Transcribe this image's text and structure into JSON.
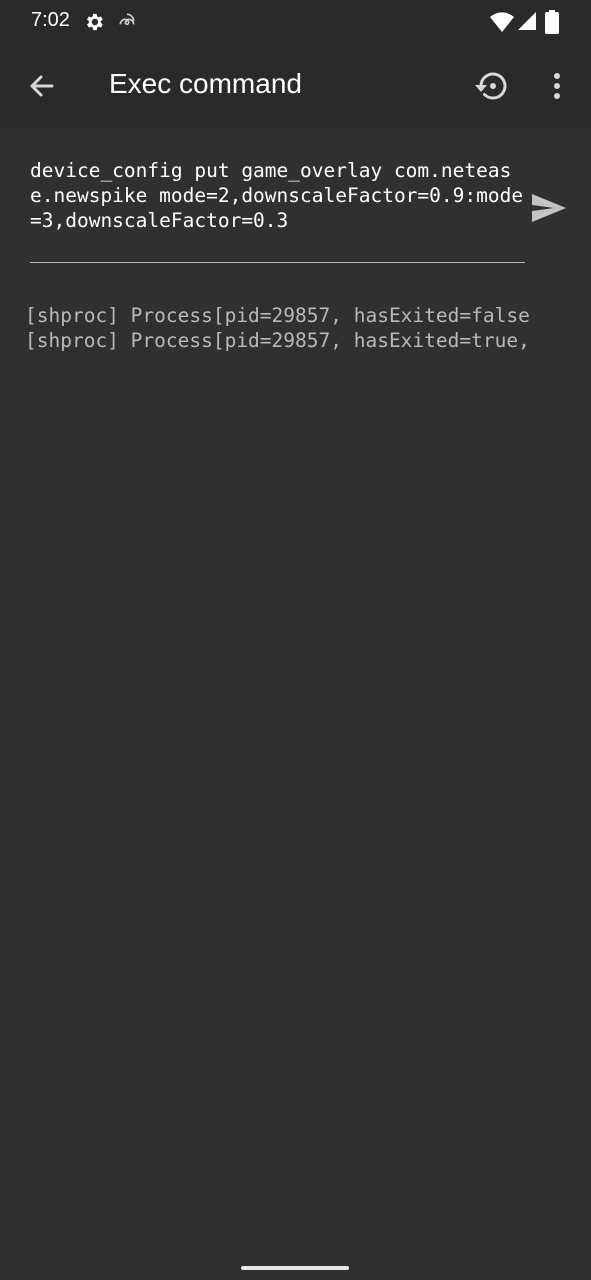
{
  "status_bar": {
    "time": "7:02",
    "icons": [
      "settings-icon",
      "swirl-icon",
      "wifi-icon",
      "signal-icon",
      "battery-icon"
    ]
  },
  "app_bar": {
    "title": "Exec command",
    "icons": [
      "back-arrow-icon",
      "history-icon",
      "more-vert-icon"
    ]
  },
  "command": {
    "value": "device_config put game_overlay com.netease.newspike mode=2,downscaleFactor=0.9:mode=3,downscaleFactor=0.3",
    "send_icon": "send-icon"
  },
  "output": {
    "lines": [
      "[shproc] Process[pid=29857, hasExited=false",
      "[shproc] Process[pid=29857, hasExited=true,"
    ]
  },
  "colors": {
    "background": "#303030",
    "app_bar": "#2a2a2a",
    "text_primary": "#ffffff",
    "text_secondary": "#b9b9b9"
  }
}
